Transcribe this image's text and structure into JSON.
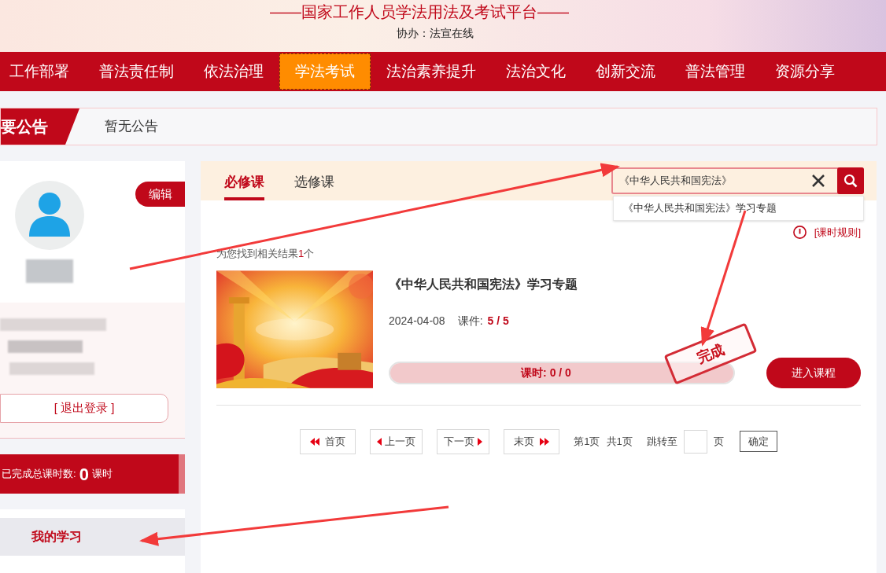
{
  "header": {
    "title": "——国家工作人员学法用法及考试平台——",
    "subtitle": "协办：法宣在线"
  },
  "nav": [
    {
      "label": "工作部署",
      "selected": false
    },
    {
      "label": "普法责任制",
      "selected": false
    },
    {
      "label": "依法治理",
      "selected": false
    },
    {
      "label": "学法考试",
      "selected": true
    },
    {
      "label": "法治素养提升",
      "selected": false
    },
    {
      "label": "法治文化",
      "selected": false
    },
    {
      "label": "创新交流",
      "selected": false
    },
    {
      "label": "普法管理",
      "selected": false
    },
    {
      "label": "资源分享",
      "selected": false
    }
  ],
  "notice": {
    "label": "要公告",
    "text": "暂无公告"
  },
  "profile": {
    "edit_button": "编辑",
    "logout": "[ 退出登录 ]",
    "hours_label": "已完成总课时数:",
    "hours_value": "0",
    "hours_unit": "课时"
  },
  "sidebar_menu": [
    {
      "label": "我的学习",
      "selected": true
    }
  ],
  "course_tabs": [
    {
      "label": "必修课",
      "selected": true
    },
    {
      "label": "选修课",
      "selected": false
    }
  ],
  "search": {
    "value": "《中华人民共和国宪法》",
    "suggestions": [
      "《中华人民共和国宪法》学习专题"
    ]
  },
  "rules_link": "[课时规则]",
  "result_summary": {
    "before": "为您找到相关结果",
    "count": "1",
    "after": "个"
  },
  "courses": [
    {
      "kind": "picture",
      "title": "《中华人民共和国宪法》学习专题",
      "date": "2024-04-08",
      "files_label": "课件:",
      "files_value": "5 / 5",
      "progress_label": "课时:",
      "progress_value": "0 / 0",
      "level": 1,
      "stamp": "完成",
      "button": "进入课程"
    }
  ],
  "pagination": {
    "first": "首页",
    "prev": "上一页",
    "next": "下一页",
    "last": "末页",
    "page_info": "第1页",
    "total_info": "共1页",
    "jump_label": "跳转至",
    "jump_unit": "页",
    "confirm": "确定"
  }
}
